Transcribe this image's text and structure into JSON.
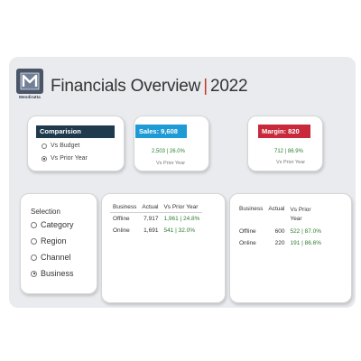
{
  "brand": {
    "logo_text": "Mendiratta",
    "logo_letter": "M"
  },
  "header": {
    "title_main": "Financials Overview",
    "title_sep": "|",
    "title_year": "2022"
  },
  "comparison": {
    "label": "Comparision",
    "options": [
      {
        "label": "Vs Budget",
        "selected": false
      },
      {
        "label": "Vs Prior Year",
        "selected": true
      }
    ]
  },
  "kpis": {
    "sales": {
      "label": "Sales: 9,608",
      "sub": "2,503 |  26.0%",
      "caption": "Vs Prior Year",
      "color": "#1e9ad6"
    },
    "margin": {
      "label": "Margin: 820",
      "sub": "712 |  86.9%",
      "caption": "Vs Prior Year",
      "color": "#c8293b"
    }
  },
  "selection": {
    "label": "Selection",
    "options": [
      {
        "label": "Category",
        "selected": false
      },
      {
        "label": "Region",
        "selected": false
      },
      {
        "label": "Channel",
        "selected": false
      },
      {
        "label": "Business",
        "selected": true
      }
    ]
  },
  "sales_table": {
    "headers": [
      "Business",
      "Actual",
      "Vs Prior Year"
    ],
    "rows": [
      {
        "business": "Offline",
        "actual": "7,917",
        "vs": "1,961 | 24.8%"
      },
      {
        "business": "Online",
        "actual": "1,691",
        "vs": "541 | 32.0%"
      }
    ]
  },
  "margin_table": {
    "headers": [
      "Business",
      "Actual",
      "Vs Prior Year"
    ],
    "rows": [
      {
        "business": "Offline",
        "actual": "600",
        "vs": "522 | 87.0%"
      },
      {
        "business": "Online",
        "actual": "220",
        "vs": "191 | 86.6%"
      }
    ]
  }
}
